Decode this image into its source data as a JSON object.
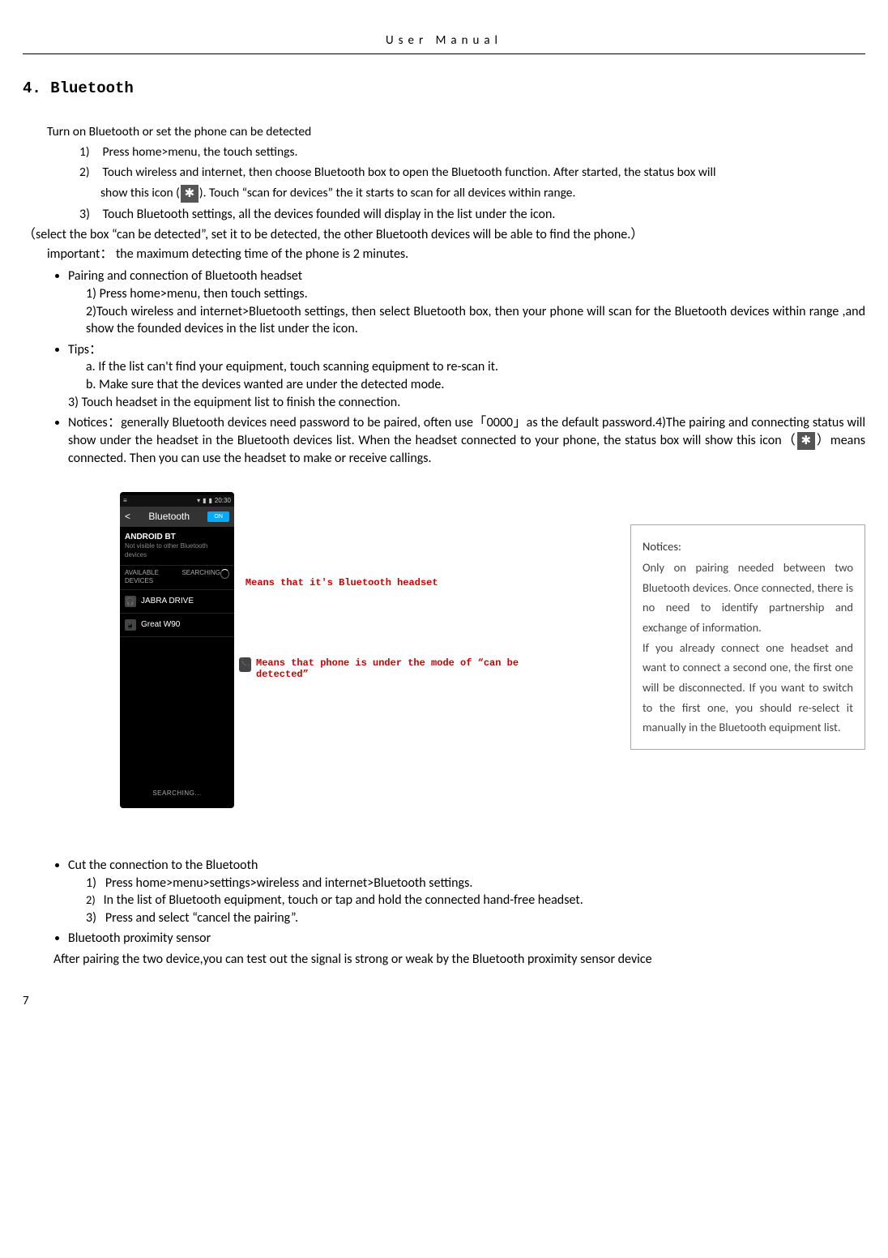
{
  "header": {
    "title": "User  Manual"
  },
  "section": {
    "heading": "4. Bluetooth"
  },
  "intro": "Turn on Bluetooth or set the phone can be detected",
  "steps": {
    "s1_num": "1)",
    "s1": "Press home>menu, the touch settings.",
    "s2_num": "2)",
    "s2a": "Touch wireless and internet, then choose Bluetooth box to open the Bluetooth function. After started, the status box will",
    "s2b_pre": "show this icon (",
    "s2b_post": "). Touch  “scan for devices” the it starts to scan for all devices within range.",
    "s3_num": "3)",
    "s3": "Touch Bluetooth settings, all the devices founded will display in the list under the icon."
  },
  "notes": {
    "paren": "（select the box “can be detected”, set it to be detected, the other Bluetooth devices will be able to find the phone.）",
    "important": "important： the maximum detecting time of the phone is 2 minutes."
  },
  "bullets": {
    "b1_title": "Pairing and connection of Bluetooth headset",
    "b1_1": "1) Press home>menu, then touch settings.",
    "b1_2": "2)Touch wireless and internet>Bluetooth settings, then select Bluetooth box, then your phone will scan for the Bluetooth devices within range ,and show the founded devices in the list under the icon.",
    "b2_title": "Tips：",
    "b2_a": "a.  If the list can't find your equipment, touch scanning equipment to re-scan it.",
    "b2_b": "b.  Make sure that the devices wanted are under the detected mode.",
    "b2_3": "3) Touch headset in the equipment list to finish the connection.",
    "b3_a": "Notices：generally Bluetooth devices need password to be paired, often use「0000」as the default password.4)The pairing and connecting status will show under the headset in the Bluetooth devices list. When the headset",
    "b3_b_pre": "connected to your phone, the status box will show this icon（",
    "b3_b_post": "）means connected. Then you can use the headset to make or receive callings."
  },
  "phone": {
    "time": "20:30",
    "title": "Bluetooth",
    "toggle": "ON",
    "devname": "ANDROID BT",
    "devsub": "Not visible to other Bluetooth devices",
    "avail": "AVAILABLE DEVICES",
    "searching": "SEARCHING",
    "dev1": "JABRA DRIVE",
    "dev2": "Great W90",
    "footer": "SEARCHING..."
  },
  "callouts": {
    "c1": "Means that it's Bluetooth headset",
    "c2": "Means that phone is under the mode of “can be detected”"
  },
  "noticesBox": {
    "title": "Notices:",
    "body": "Only on pairing needed between two Bluetooth devices. Once connected, there is no need to identify partnership and exchange of information.\nIf you already connect one headset and want to connect a second one, the first one will be disconnected. If you want to switch to the first one, you should re-select it manually in the Bluetooth equipment list."
  },
  "section2": {
    "b4_title": "Cut the connection to the Bluetooth",
    "b4_1_num": "1)",
    "b4_1": "Press home>menu>settings>wireless and internet>Bluetooth settings.",
    "b4_2_num": "2)",
    "b4_2": "In the list of Bluetooth equipment, touch or tap and hold the connected hand-free headset.",
    "b4_3_num": "3)",
    "b4_3": "Press and select “cancel the pairing”.",
    "b5_title": "Bluetooth proximity sensor",
    "b5_body": "After pairing the two device,you can test out the signal is strong or weak by the Bluetooth proximity sensor device"
  },
  "pageNumber": "7"
}
